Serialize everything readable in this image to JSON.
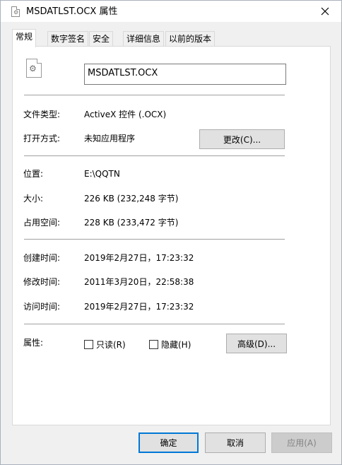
{
  "window": {
    "title": "MSDATLST.OCX 属性"
  },
  "tabs": [
    {
      "label": "常规"
    },
    {
      "label": "数字签名"
    },
    {
      "label": "安全"
    },
    {
      "label": "详细信息"
    },
    {
      "label": "以前的版本"
    }
  ],
  "general": {
    "file_name": "MSDATLST.OCX",
    "file_type_label": "文件类型:",
    "file_type_value": "ActiveX 控件 (.OCX)",
    "open_with_label": "打开方式:",
    "open_with_value": "未知应用程序",
    "change_button": "更改(C)...",
    "location_label": "位置:",
    "location_value": "E:\\QQTN",
    "size_label": "大小:",
    "size_value": "226 KB (232,248 字节)",
    "size_on_disk_label": "占用空间:",
    "size_on_disk_value": "228 KB (233,472 字节)",
    "created_label": "创建时间:",
    "created_value": "2019年2月27日，17:23:32",
    "modified_label": "修改时间:",
    "modified_value": "2011年3月20日，22:58:38",
    "accessed_label": "访问时间:",
    "accessed_value": "2019年2月27日，17:23:32",
    "attributes_label": "属性:",
    "readonly_label": "只读(R)",
    "hidden_label": "隐藏(H)",
    "advanced_button": "高级(D)..."
  },
  "footer": {
    "ok": "确定",
    "cancel": "取消",
    "apply": "应用(A)"
  },
  "colors": {
    "accent": "#0078d7"
  }
}
